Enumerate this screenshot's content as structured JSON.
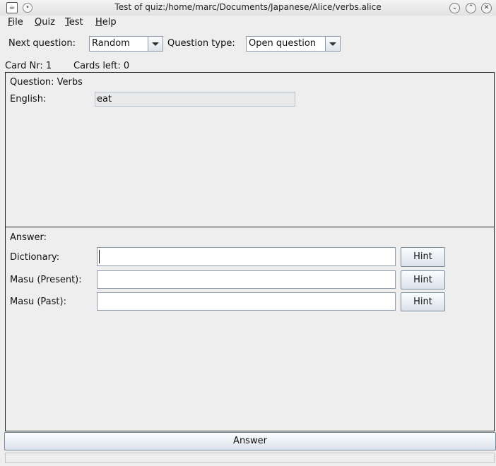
{
  "window": {
    "title": "Test of quiz:/home/marc/Documents/Japanese/Alice/verbs.alice"
  },
  "menubar": {
    "items": [
      {
        "label": "File",
        "mnemonic": "F",
        "rest": "ile"
      },
      {
        "label": "Quiz",
        "mnemonic": "Q",
        "rest": "uiz"
      },
      {
        "label": "Test",
        "mnemonic": "T",
        "rest": "est"
      },
      {
        "label": "Help",
        "mnemonic": "H",
        "rest": "elp"
      }
    ]
  },
  "toolbar": {
    "next_question_label": "Next question:",
    "next_question_value": "Random",
    "question_type_label": "Question type:",
    "question_type_value": "Open question"
  },
  "status": {
    "card_nr": "Card Nr: 1",
    "cards_left": "Cards left: 0"
  },
  "question": {
    "heading": "Question: Verbs",
    "field_label": "English:",
    "field_value": "eat"
  },
  "answer": {
    "heading": "Answer:",
    "fields": [
      {
        "label": "Dictionary:",
        "value": "",
        "hint": "Hint"
      },
      {
        "label": "Masu (Present):",
        "value": "",
        "hint": "Hint"
      },
      {
        "label": "Masu (Past):",
        "value": "",
        "hint": "Hint"
      }
    ]
  },
  "answer_button": "Answer",
  "icons": {
    "app": "java-app-icon",
    "menu": "window-menu-icon",
    "minimize": "chevron-down-icon",
    "maximize": "chevron-up-icon",
    "close": "close-icon"
  }
}
